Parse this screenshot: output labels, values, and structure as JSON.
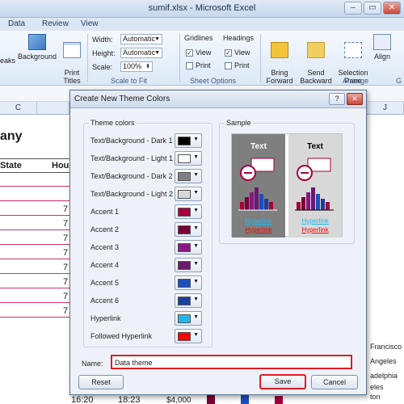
{
  "window": {
    "title": "sumif.xlsx - Microsoft Excel",
    "min": "–",
    "max": "▭",
    "close": "✕"
  },
  "ribbon_tabs": [
    "Data",
    "Review",
    "View"
  ],
  "ribbon": {
    "breaks_label": "eaks",
    "background_label": "Background",
    "print_titles_label": "Print\nTitles",
    "width_label": "Width:",
    "width_value": "Automatic",
    "height_label": "Height:",
    "height_value": "Automatic",
    "scale_label": "Scale:",
    "scale_value": "100%",
    "scale_group": "Scale to Fit",
    "gridlines_label": "Gridlines",
    "headings_label": "Headings",
    "view_label": "View",
    "print_label": "Print",
    "sheet_options_group": "Sheet Options",
    "bring_forward": "Bring\nForward",
    "send_backward": "Send\nBackward",
    "selection_pane": "Selection\nPane",
    "align_label": "Align",
    "arrange_group": "Arrange",
    "g_label": "G"
  },
  "sheet": {
    "col_c": "C",
    "col_j": "J",
    "company_fragment": "any",
    "header_state": "State",
    "header_hou": "Hou",
    "row_nums": [
      "7",
      "7",
      "7",
      "7",
      "7",
      "7",
      "7",
      "7"
    ],
    "bottom_vals": [
      "16:20",
      "18:23",
      "$4,000"
    ],
    "right_texts": [
      "Francisco",
      "Angeles",
      "adelphia",
      "eles",
      "ton"
    ]
  },
  "dialog": {
    "title": "Create New Theme Colors",
    "help": "?",
    "close": "✕",
    "theme_colors_label": "Theme colors",
    "rows": [
      {
        "label": "Text/Background - Dark 1",
        "color": "#000000"
      },
      {
        "label": "Text/Background - Light 1",
        "color": "#ffffff"
      },
      {
        "label": "Text/Background - Dark 2",
        "color": "#7f7f7f"
      },
      {
        "label": "Text/Background - Light 2",
        "color": "#d8d8d8"
      },
      {
        "label": "Accent 1",
        "color": "#a6003c"
      },
      {
        "label": "Accent 2",
        "color": "#7a0035"
      },
      {
        "label": "Accent 3",
        "color": "#8b1686"
      },
      {
        "label": "Accent 4",
        "color": "#6a1a6e"
      },
      {
        "label": "Accent 5",
        "color": "#1d4fbf"
      },
      {
        "label": "Accent 6",
        "color": "#1b3f9c"
      },
      {
        "label": "Hyperlink",
        "color": "#22b6f0"
      },
      {
        "label": "Followed Hyperlink",
        "color": "#ff0000"
      }
    ],
    "sample_label": "Sample",
    "sample_text": "Text",
    "sample_hyperlink": "Hyperlink",
    "sample_followed": "Hyperlink",
    "name_label": "Name:",
    "name_value": "Data theme",
    "reset_label": "Reset",
    "save_label": "Save",
    "cancel_label": "Cancel"
  }
}
